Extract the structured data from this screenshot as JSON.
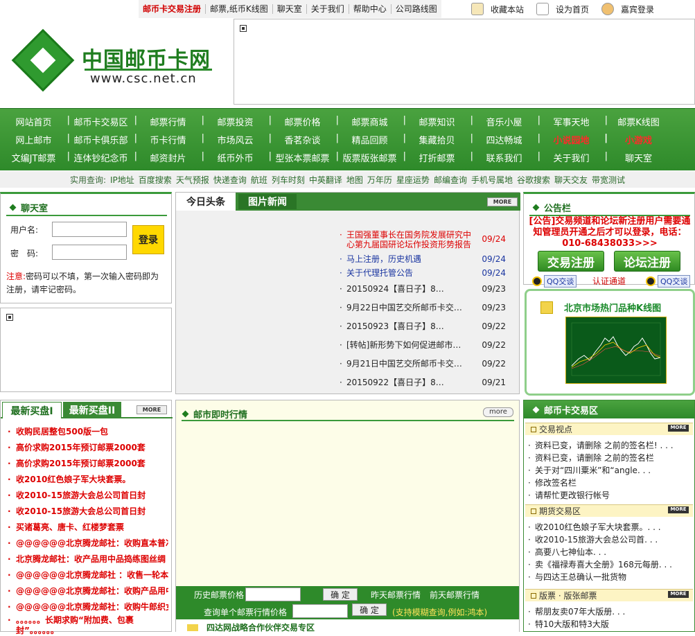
{
  "top_links": [
    "邮币卡交易注册",
    "邮票,纸币K线图",
    "聊天室",
    "关于我们",
    "帮助中心",
    "公司路线图"
  ],
  "top_tools": [
    "收藏本站",
    "设为首页",
    "嘉宾登录"
  ],
  "logo": {
    "name": "中国邮币卡网",
    "url": "www.csc.net.cn"
  },
  "nav_rows": [
    [
      "网站首页",
      "邮币卡交易区",
      "邮票行情",
      "邮票投资",
      "邮票价格",
      "邮票商城",
      "邮票知识",
      "音乐小屋",
      "军事天地",
      "邮票K线图"
    ],
    [
      "网上邮市",
      "邮币卡俱乐部",
      "币卡行情",
      "市场风云",
      "香茗杂谈",
      "精品回顾",
      "集藏拾贝",
      "四达畅城",
      "小说园地",
      "小游戏"
    ],
    [
      "文编JT邮票",
      "连体钞纪念币",
      "邮资封片",
      "纸币外币",
      "型张本票邮票",
      "版票版张邮票",
      "打折邮票",
      "联系我们",
      "关于我们",
      "聊天室"
    ]
  ],
  "util": {
    "label": "实用查询:",
    "items": [
      "IP地址",
      "百度搜索",
      "天气预报",
      "快递查询",
      "航班",
      "列车时刻",
      "中英翻译",
      "地图",
      "万年历",
      "星座运势",
      "邮编查询",
      "手机号属地",
      "谷歌搜索",
      "聊天交友",
      "带宽测试"
    ]
  },
  "chat": {
    "title": "聊天室",
    "user_label": "用户名:",
    "pass_label": "密　码:",
    "login": "登录",
    "note_prefix": "注意:",
    "note": "密码可以不填，第一次输入密码即为注册，请牢记密码。"
  },
  "headlines": {
    "tab1": "今日头条",
    "tab2": "图片新闻",
    "more": "MORE",
    "items": [
      {
        "text": "王国强董事长在国务院发展研究中心第九届国研论坛作投资形势报告",
        "date": "09/24",
        "style": "red"
      },
      {
        "text": "马上注册，历史机遇",
        "date": "09/24",
        "style": "blue"
      },
      {
        "text": "关于代理托管公告",
        "date": "09/24",
        "style": "blue"
      },
      {
        "text": "20150924【喜日子】8…",
        "date": "09/23",
        "style": ""
      },
      {
        "text": "9月22日中国艺交所邮币卡交…",
        "date": "09/23",
        "style": ""
      },
      {
        "text": "20150923【喜日子】8…",
        "date": "09/22",
        "style": ""
      },
      {
        "text": "[转帖]新形势下如何促进邮市…",
        "date": "09/22",
        "style": ""
      },
      {
        "text": "9月21日中国艺交所邮币卡交…",
        "date": "09/22",
        "style": ""
      },
      {
        "text": "20150922【喜日子】8…",
        "date": "09/21",
        "style": ""
      }
    ]
  },
  "notice": {
    "title": "公告栏",
    "text": "[公告]交易频道和论坛新注册用户需要通知管理员开通之后才可以登录，电话：010-68438033>>>",
    "btn1": "交易注册",
    "btn2": "论坛注册",
    "qq": "QQ交谈",
    "mid": "认证通道"
  },
  "kline": {
    "title": "北京市场热门品种K线图"
  },
  "buy": {
    "tab1": "最新买盘I",
    "tab2": "最新买盘II",
    "more": "MORE",
    "items": [
      "收购民居整包500版一包",
      "高价求购2015年预订邮票2000套",
      "高价求购2015年预订邮票2000套",
      "收2010红色娘子军大块套票。",
      "收2010-15旅游大会总公司首日封",
      "收2010-15旅游大会总公司首日封",
      "买诸葛亮、唐卡、红楼梦套票",
      "@@@@@@北京腾龙邮社：收购直本普冲票",
      "北京腾龙邮社：收产品用中品捣练图丝绸",
      "@@@@@@北京腾龙邮社 ：收售一轮本票",
      "@@@@@@北京腾龙邮社：收购产品用中品",
      "@@@@@@北京腾龙邮社：收购牛郎织女邮票",
      "。。。。。。长期求购“附加费、包裹封”。。。。。。"
    ]
  },
  "market": {
    "title": "邮市即时行情",
    "more": "more",
    "hist_label": "历史邮票价格",
    "confirm": "确 定",
    "yesterday": "昨天邮票行情",
    "daybefore": "前天邮票行情",
    "single_label": "查询单个邮票行情价格",
    "fuzzy": "(支持模糊查询,例如:鸿本)",
    "bottom": "四达网战略合作伙伴交易专区"
  },
  "trade": {
    "title": "邮币卡交易区",
    "sections": [
      {
        "name": "交易视点",
        "items": [
          "资料已变，请删除 之前的签名栏! . . .",
          "资料已变，请删除 之前的签名栏",
          "关于对“四川粟米”和“angle. . .",
          "修改签名栏",
          "请帮忙更改银行帐号"
        ]
      },
      {
        "name": "期货交易区",
        "items": [
          "收2010红色娘子军大块套票。. . .",
          "收2010-15旅游大会总公司首. . .",
          "高要八七神仙本. . .",
          "卖《福禄寿喜大全册》168元每册. . .",
          "与四达王总确认一批货物"
        ]
      },
      {
        "name": "版票 · 版张邮票",
        "items": [
          "帮朋友卖07年大版册. . .",
          "特10大版和特3大版"
        ]
      }
    ],
    "more": "MORE"
  }
}
